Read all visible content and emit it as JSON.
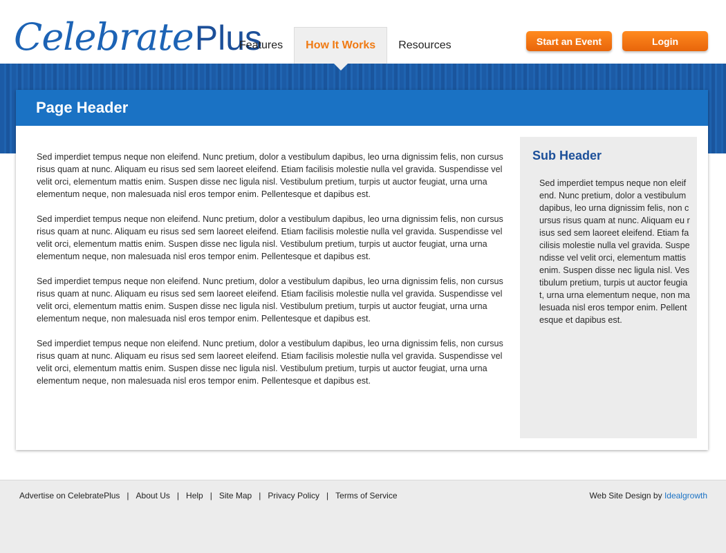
{
  "brand": {
    "script": "Celebrate",
    "plus": "Plus"
  },
  "nav": [
    {
      "label": "Features",
      "active": false
    },
    {
      "label": "How It Works",
      "active": true
    },
    {
      "label": "Resources",
      "active": false
    }
  ],
  "buttons": {
    "start": "Start an Event",
    "login": "Login"
  },
  "page": {
    "header": "Page Header",
    "paragraphs": [
      "Sed imperdiet tempus neque non eleifend. Nunc pretium, dolor a vestibulum dapibus, leo urna dignissim felis, non cursus risus quam at nunc. Aliquam eu risus sed sem laoreet eleifend. Etiam facilisis molestie nulla vel gravida. Suspendisse vel velit orci, elementum mattis enim. Suspen disse nec ligula nisl. Vestibulum pretium, turpis ut auctor feugiat, urna urna elementum neque, non malesuada nisl eros tempor enim. Pellentesque et dapibus est.",
      "Sed imperdiet tempus neque non eleifend. Nunc pretium, dolor a vestibulum dapibus, leo urna dignissim felis, non cursus risus quam at nunc. Aliquam eu risus sed sem laoreet eleifend. Etiam facilisis molestie nulla vel gravida. Suspendisse vel velit orci, elementum mattis enim. Suspen disse nec ligula nisl. Vestibulum pretium, turpis ut auctor feugiat, urna urna elementum neque, non malesuada nisl eros tempor enim. Pellentesque et dapibus est.",
      "Sed imperdiet tempus neque non eleifend. Nunc pretium, dolor a vestibulum dapibus, leo urna dignissim felis, non cursus risus quam at nunc. Aliquam eu risus sed sem laoreet eleifend. Etiam facilisis molestie nulla vel gravida. Suspendisse vel velit orci, elementum mattis enim. Suspen disse nec ligula nisl. Vestibulum pretium, turpis ut auctor feugiat, urna urna elementum neque, non malesuada nisl eros tempor enim. Pellentesque et dapibus est.",
      "Sed imperdiet tempus neque non eleifend. Nunc pretium, dolor a vestibulum dapibus, leo urna dignissim felis, non cursus risus quam at nunc. Aliquam eu risus sed sem laoreet eleifend. Etiam facilisis molestie nulla vel gravida. Suspendisse vel velit orci, elementum mattis enim. Suspen disse nec ligula nisl. Vestibulum pretium, turpis ut auctor feugiat, urna urna elementum neque, non malesuada nisl eros tempor enim. Pellentesque et dapibus est."
    ]
  },
  "sidebar": {
    "header": "Sub Header",
    "text": "Sed imperdiet tempus neque non eleifend. Nunc pretium, dolor a vestibulum dapibus, leo urna dignissim felis, non cursus risus quam at nunc. Aliquam eu risus sed sem laoreet eleifend. Etiam facilisis molestie nulla vel gravida. Suspendisse vel velit orci, elementum mattis enim. Suspen disse nec ligula nisl. Vestibulum pretium, turpis ut auctor feugiat, urna urna elementum neque, non malesuada nisl eros tempor enim. Pellentesque et dapibus est."
  },
  "footer": {
    "links": [
      "Advertise on CelebratePlus",
      "About Us",
      "Help",
      "Site Map",
      "Privacy Policy",
      "Terms of Service"
    ],
    "credit_prefix": "Web Site Design by",
    "credit_link": "Idealgrowth"
  },
  "colors": {
    "brand_blue": "#1c63b5",
    "header_blue": "#1a72c4",
    "accent_orange": "#f07a12"
  }
}
